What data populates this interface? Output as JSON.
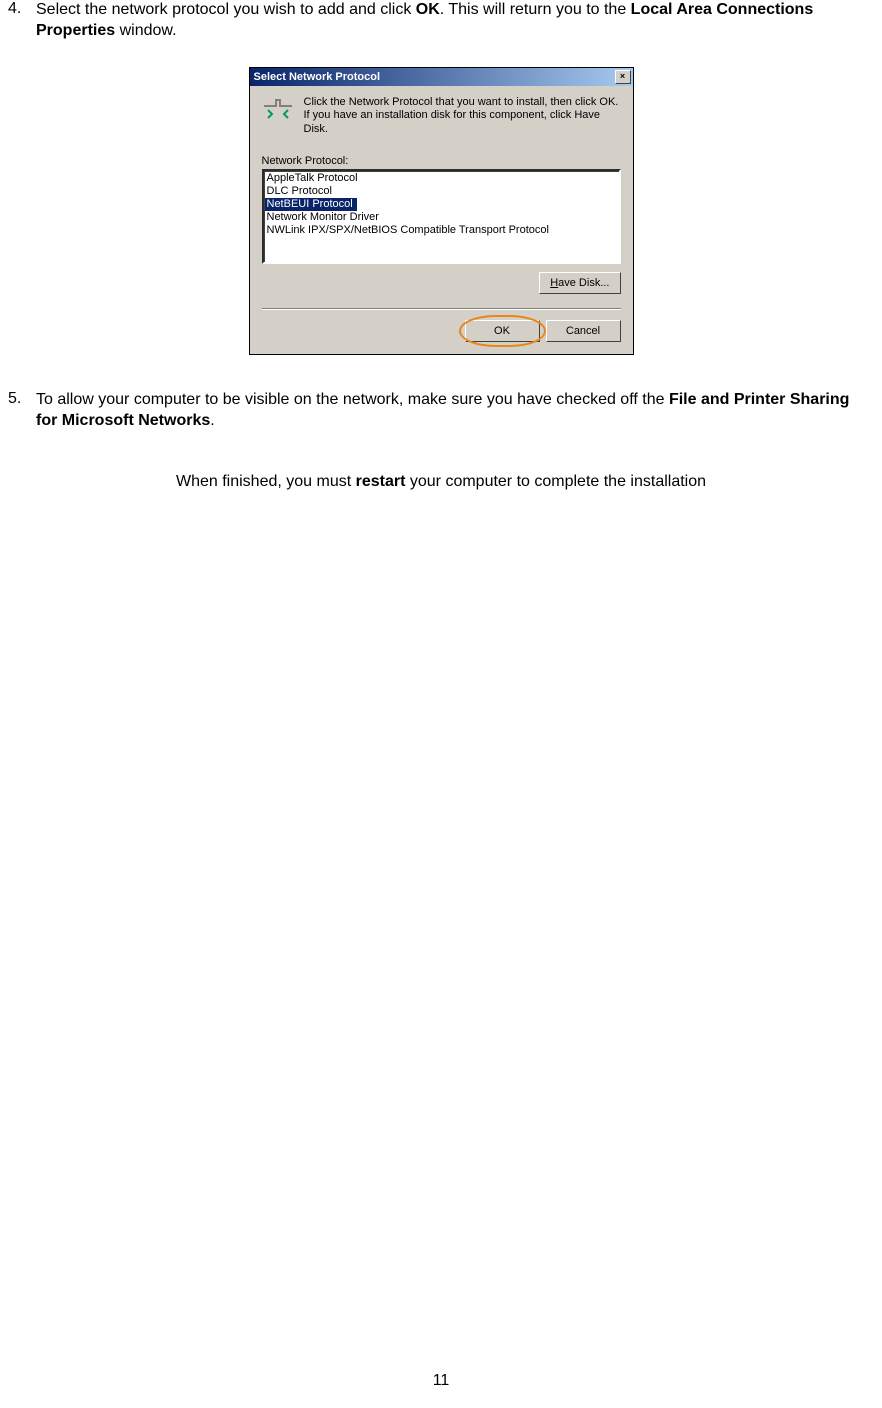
{
  "steps": {
    "s4": {
      "num": "4.",
      "t1": "Select the network protocol you wish to add and click ",
      "b1": "OK",
      "t2": ". This will return you to the ",
      "b2": "Local Area Connections Properties",
      "t3": " window."
    },
    "s5": {
      "num": "5.",
      "t1": "To allow your computer to be visible on the network, make sure you have checked off the ",
      "b1": "File and Printer Sharing for Microsoft Networks",
      "t2": "."
    }
  },
  "dialog": {
    "title": "Select Network Protocol",
    "close": "×",
    "instruction": "Click the Network Protocol that you want to install, then click OK. If you have an installation disk for this component, click Have Disk.",
    "listLabel": "Network Protocol:",
    "items": [
      "AppleTalk Protocol",
      "DLC Protocol",
      "NetBEUI Protocol",
      "Network Monitor Driver",
      "NWLink IPX/SPX/NetBIOS Compatible Transport Protocol"
    ],
    "selectedIndex": 2,
    "haveDisk": {
      "pre": "H",
      "rest": "ave Disk..."
    },
    "ok": "OK",
    "cancel": "Cancel"
  },
  "note": {
    "t1": "When finished, you must ",
    "b1": "restart",
    "t2": " your computer to complete the installation"
  },
  "pageNumber": "11"
}
